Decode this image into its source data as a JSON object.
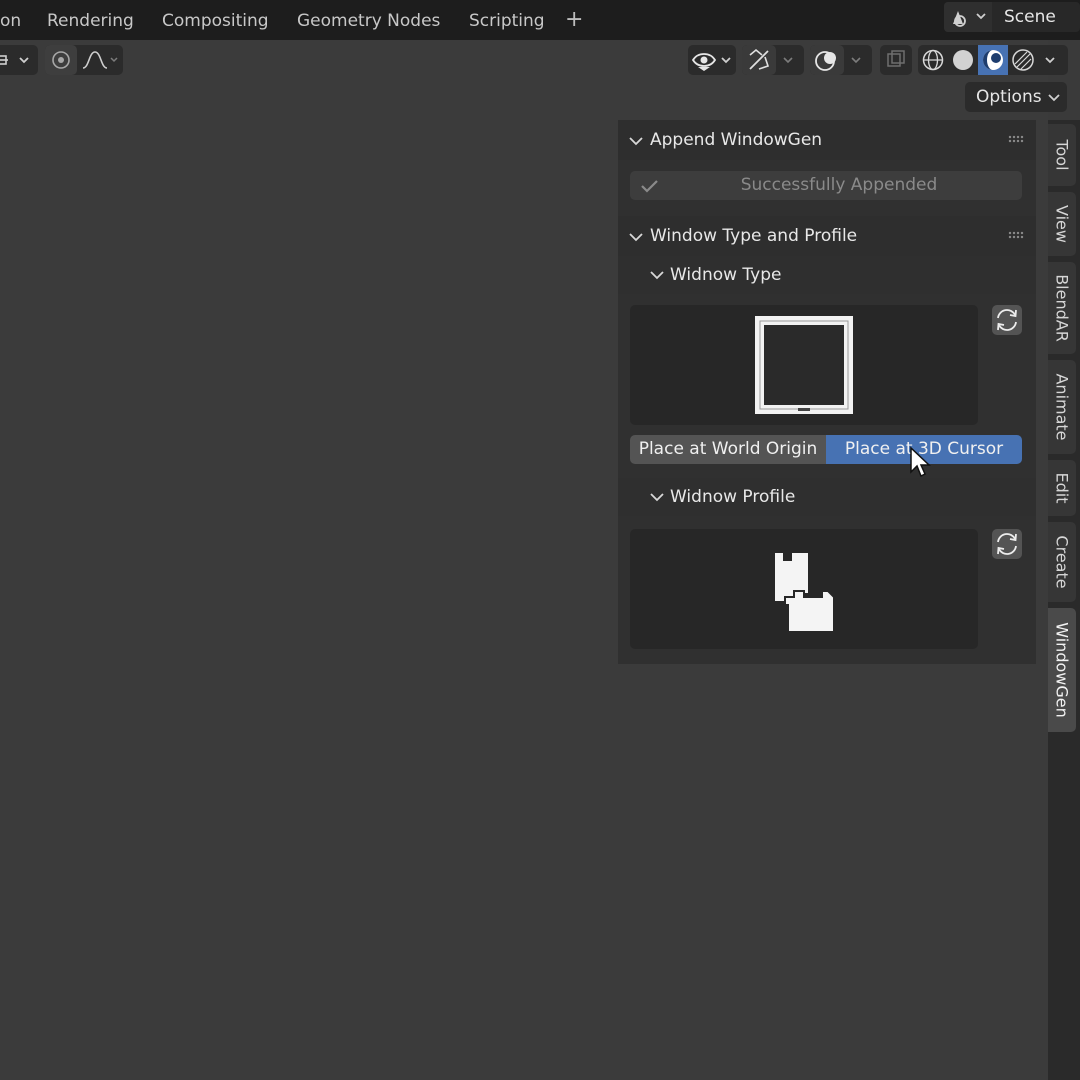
{
  "workspace_tabs": [
    {
      "label": "on"
    },
    {
      "label": "Rendering"
    },
    {
      "label": "Compositing"
    },
    {
      "label": "Geometry Nodes"
    },
    {
      "label": "Scripting"
    }
  ],
  "add_workspace_icon": "plus-icon",
  "scene": {
    "label": "Scene",
    "icon": "scene-icon"
  },
  "viewport_header": {
    "options_label": "Options",
    "icons": [
      "transform-pivot-icon",
      "snap-icon",
      "proportional-falloff-icon",
      "visibility-icon",
      "gizmo-icon",
      "overlay-icon",
      "xray-icon",
      "wireframe-shading-icon",
      "solid-shading-icon",
      "material-preview-icon",
      "rendered-shading-icon"
    ],
    "active_shading": "material-preview"
  },
  "npanel": {
    "append_panel": {
      "title": "Append WindowGen",
      "status_label": "Successfully Appended",
      "status_icon": "checkmark-icon"
    },
    "window_panel": {
      "title": "Window Type and Profile",
      "type_section": {
        "title": "Widnow Type",
        "refresh_icon": "refresh-icon",
        "place_world_origin": "Place at World Origin",
        "place_3d_cursor": "Place at 3D Cursor",
        "active_placement": "place_3d_cursor"
      },
      "profile_section": {
        "title": "Widnow Profile",
        "refresh_icon": "refresh-icon"
      }
    }
  },
  "sidebar_tabs": [
    {
      "label": "Tool"
    },
    {
      "label": "View"
    },
    {
      "label": "BlendAR"
    },
    {
      "label": "Animate"
    },
    {
      "label": "Edit"
    },
    {
      "label": "Create"
    },
    {
      "label": "WindowGen"
    }
  ],
  "active_sidebar_tab": "WindowGen",
  "colors": {
    "accent": "#4772b3",
    "background": "#3b3b3b",
    "panel": "#303030",
    "topbar": "#1d1d1d"
  }
}
